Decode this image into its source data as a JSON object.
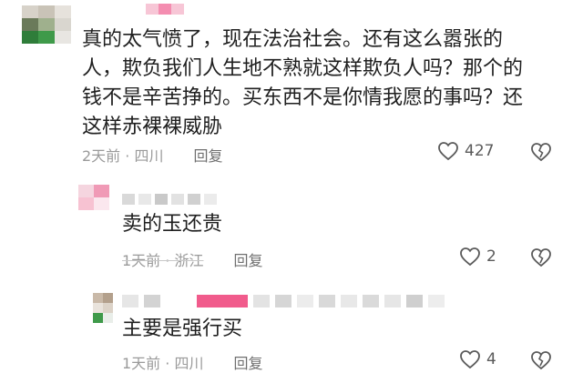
{
  "comments": [
    {
      "text_lines": [
        "真的太气愤了，现在法治社会。还有这么嚣张的",
        "人，欺负我们人生地不熟就这样欺负人吗？那个的",
        "钱不是辛苦挣的。买东西不是你情我愿的事吗？还",
        "这样赤裸裸威胁"
      ],
      "time_location": "2天前 · 四川",
      "reply_label": "回复",
      "like_count": "427"
    },
    {
      "text_lines": [
        "卖的玉还贵"
      ],
      "time_location": "1天前 · 浙江",
      "reply_label": "回复",
      "like_count": "2"
    },
    {
      "text_lines": [
        "主要是强行买"
      ],
      "time_location": "1天前 · 四川",
      "reply_label": "回复",
      "like_count": "4"
    }
  ],
  "icons": {
    "like": "heart-outline-icon",
    "dislike": "broken-heart-icon"
  },
  "colors": {
    "text": "#1f1f1f",
    "meta": "#9a9a9a",
    "accent_pink": "#f15b8c"
  }
}
